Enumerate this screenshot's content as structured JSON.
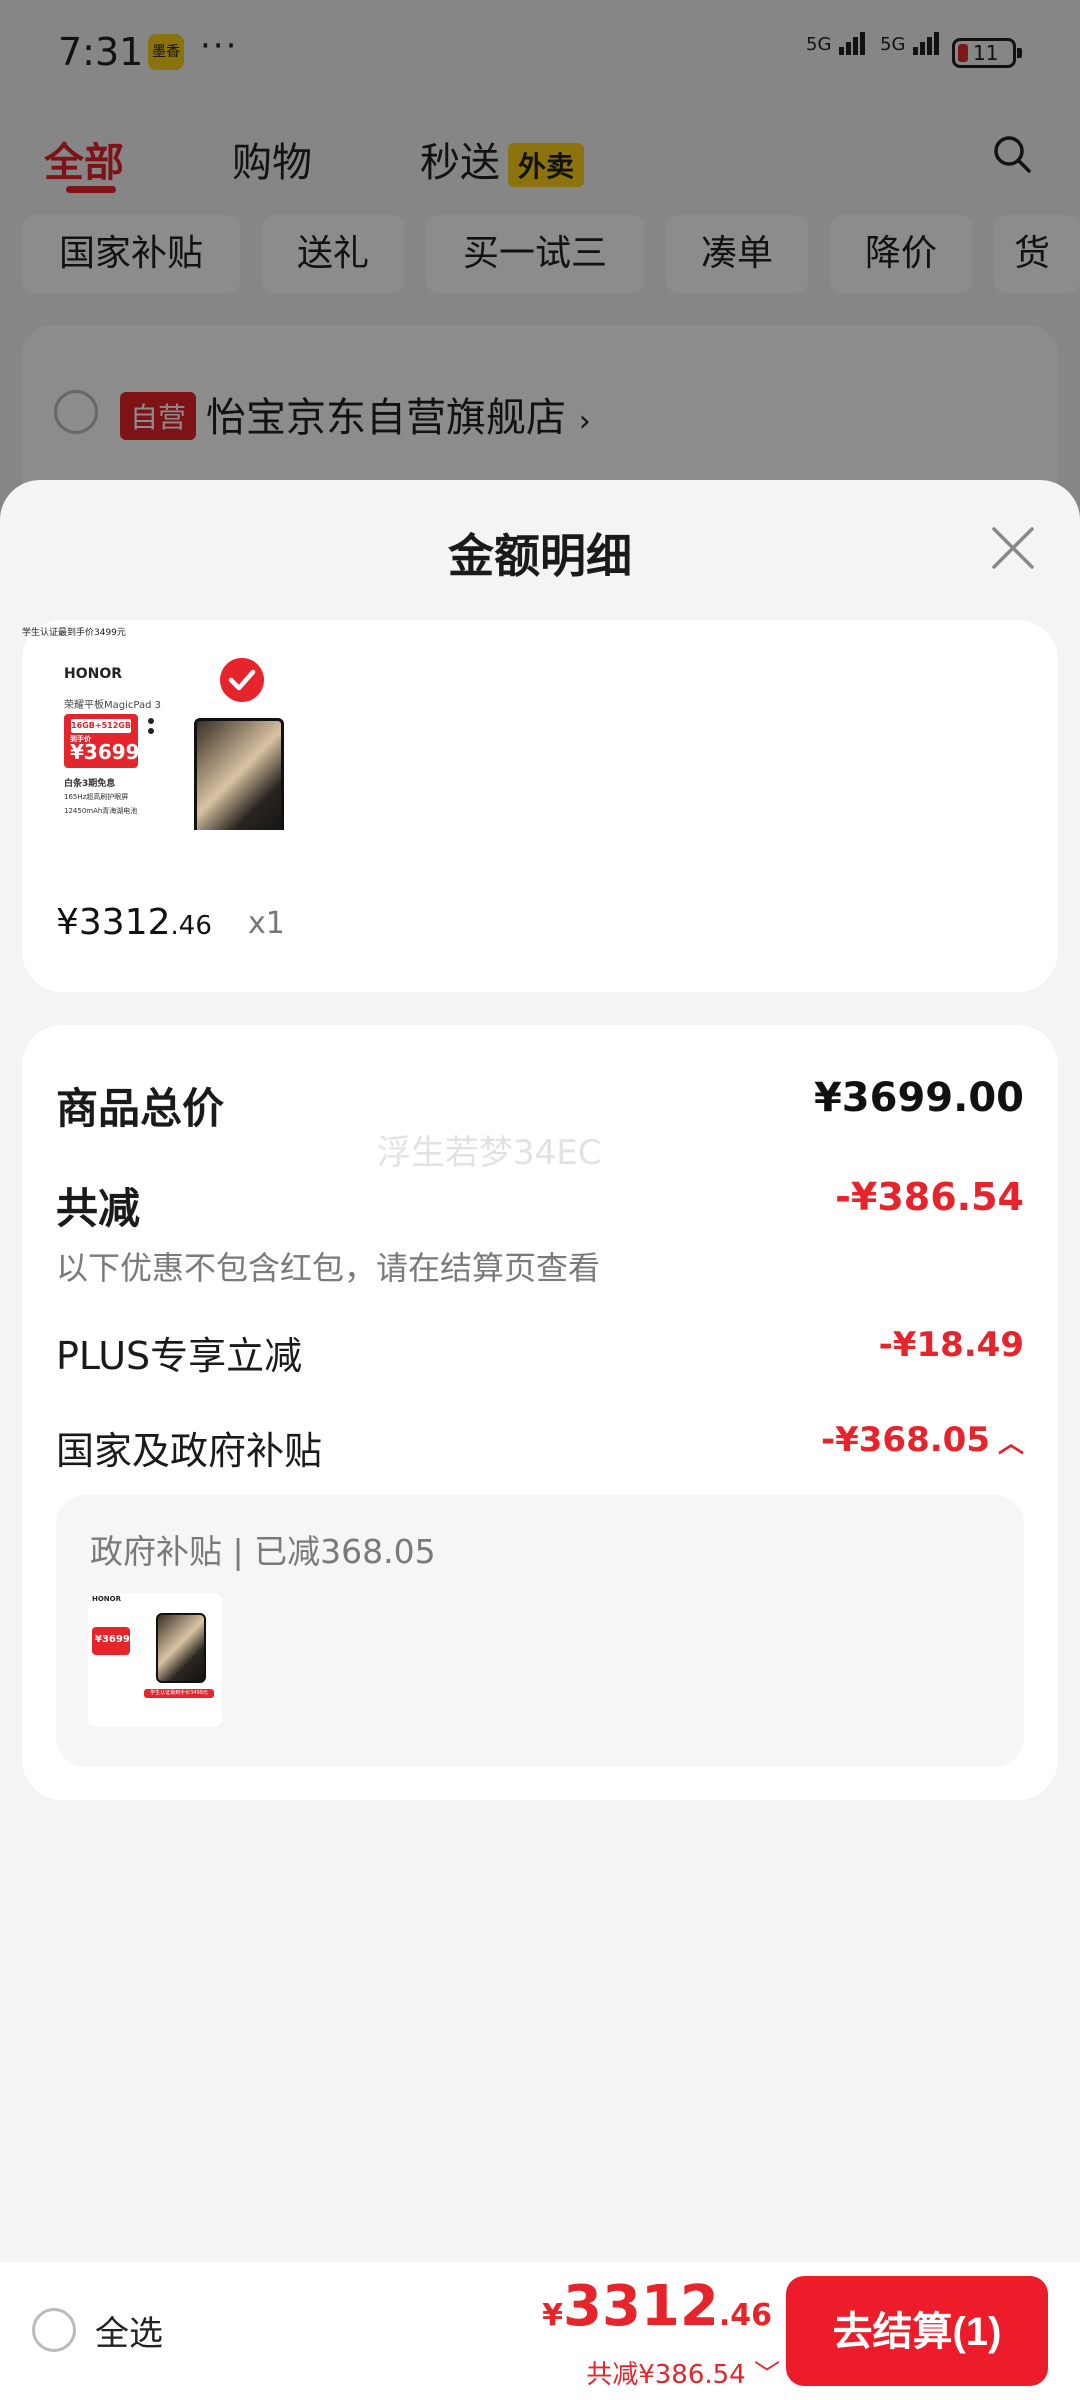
{
  "status_bar": {
    "time": "7:31",
    "app_icon_label": "墨香",
    "more": "···",
    "signal_1": "5G",
    "signal_2": "5G",
    "battery": "11"
  },
  "top_tabs": {
    "tabs": [
      "全部",
      "购物",
      "秒送"
    ],
    "badge": "外卖",
    "active": "全部"
  },
  "chips": [
    "国家补贴",
    "送礼",
    "买一试三",
    "凑单",
    "降价",
    "货"
  ],
  "store": {
    "tag": "自营",
    "name": "怡宝京东自营旗舰店",
    "chevron": "›"
  },
  "sheet": {
    "title": "金额明细",
    "product": {
      "brand": "HONOR",
      "model": "荣耀平板MagicPad 3",
      "spec": "16GB+512GB",
      "thumb_price_label": "到手价",
      "thumb_price": "¥3699",
      "feature_1": "白条3期免息",
      "feature_2": "165Hz超高刷护眼屏",
      "feature_3": "12450mAh青海湖电池",
      "tagline": "学生认证最到手价3499元",
      "price_main": "¥3312",
      "price_decimal": ".46",
      "quantity": "x1"
    },
    "summary": {
      "total_label": "商品总价",
      "total_value": "¥3699.00",
      "reduce_label": "共减",
      "reduce_value": "-¥386.54",
      "reduce_note": "以下优惠不包含红包，请在结算页查看",
      "plus_label": "PLUS专享立减",
      "plus_value": "-¥18.49",
      "gov_label": "国家及政府补贴",
      "gov_value": "-¥368.05",
      "gov_chevron": "︿",
      "sub_panel_title": "政府补贴 | 已减368.05",
      "watermark": "浮生若梦34EC"
    }
  },
  "bottom_bar": {
    "select_all": "全选",
    "total_yen": "¥",
    "total_main": "3312",
    "total_decimal": ".46",
    "discount_note": "共减¥386.54",
    "discount_chevron": "﹀",
    "checkout": "去结算(1)"
  },
  "colors": {
    "accent_red": "#e5242b",
    "badge_yellow": "#ffd11a",
    "overlay": "rgba(0,0,0,0.45)"
  }
}
